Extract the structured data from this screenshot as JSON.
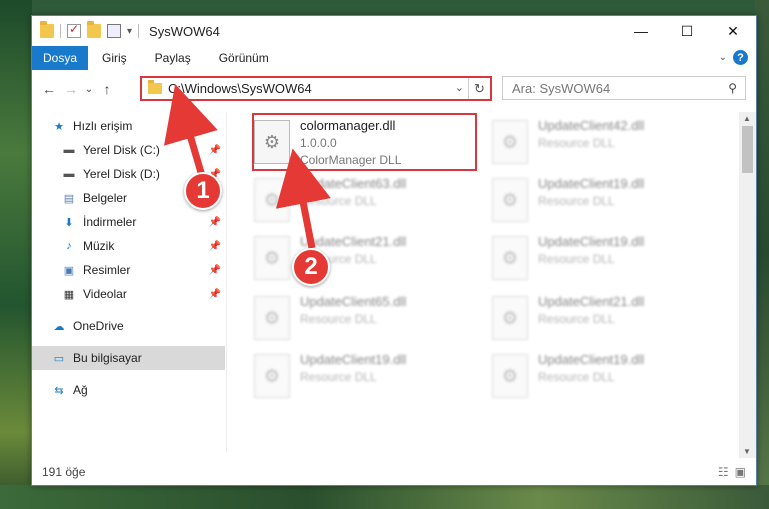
{
  "window": {
    "title": "SysWOW64",
    "minimize": "—",
    "maximize": "☐",
    "close": "✕"
  },
  "ribbon": {
    "tabs": [
      "Dosya",
      "Giriş",
      "Paylaş",
      "Görünüm"
    ],
    "expand_icon": "chevron-down-icon",
    "help_label": "?"
  },
  "nav": {
    "back": "←",
    "forward": "→",
    "recent": "⌄",
    "up": "↑",
    "address": "C:\\Windows\\SysWOW64",
    "search_placeholder": "Ara: SysWOW64"
  },
  "sidebar": {
    "items": [
      {
        "label": "Hızlı erişim",
        "icon": "star-icon",
        "pinned": false
      },
      {
        "label": "Yerel Disk (C:)",
        "icon": "drive-icon",
        "pinned": true
      },
      {
        "label": "Yerel Disk (D:)",
        "icon": "drive-icon",
        "pinned": true
      },
      {
        "label": "Belgeler",
        "icon": "document-icon",
        "pinned": true
      },
      {
        "label": "İndirmeler",
        "icon": "download-icon",
        "pinned": true
      },
      {
        "label": "Müzik",
        "icon": "music-icon",
        "pinned": true
      },
      {
        "label": "Resimler",
        "icon": "picture-icon",
        "pinned": true
      },
      {
        "label": "Videolar",
        "icon": "video-icon",
        "pinned": true
      },
      {
        "label": "OneDrive",
        "icon": "cloud-icon",
        "pinned": false
      },
      {
        "label": "Bu bilgisayar",
        "icon": "computer-icon",
        "pinned": false
      },
      {
        "label": "Ağ",
        "icon": "network-icon",
        "pinned": false
      }
    ]
  },
  "files": {
    "featured": {
      "name": "colormanager.dll",
      "version": "1.0.0.0",
      "description": "ColorManager DLL"
    },
    "left": [
      {
        "name": "UpdateClient63.dll",
        "description": "Resource DLL"
      },
      {
        "name": "UpdateClient21.dll",
        "description": "Resource DLL"
      },
      {
        "name": "UpdateClient65.dll",
        "description": "Resource DLL"
      },
      {
        "name": "UpdateClient19.dll",
        "description": "Resource DLL"
      }
    ],
    "right": [
      {
        "name": "UpdateClient42.dll",
        "description": "Resource DLL"
      },
      {
        "name": "UpdateClient19.dll",
        "description": "Resource DLL"
      },
      {
        "name": "UpdateClient19.dll",
        "description": "Resource DLL"
      },
      {
        "name": "UpdateClient21.dll",
        "description": "Resource DLL"
      },
      {
        "name": "UpdateClient19.dll",
        "description": "Resource DLL"
      }
    ]
  },
  "status": {
    "count": "191 öğe"
  },
  "annotations": {
    "step1": "1",
    "step2": "2",
    "color": "#e53935"
  }
}
